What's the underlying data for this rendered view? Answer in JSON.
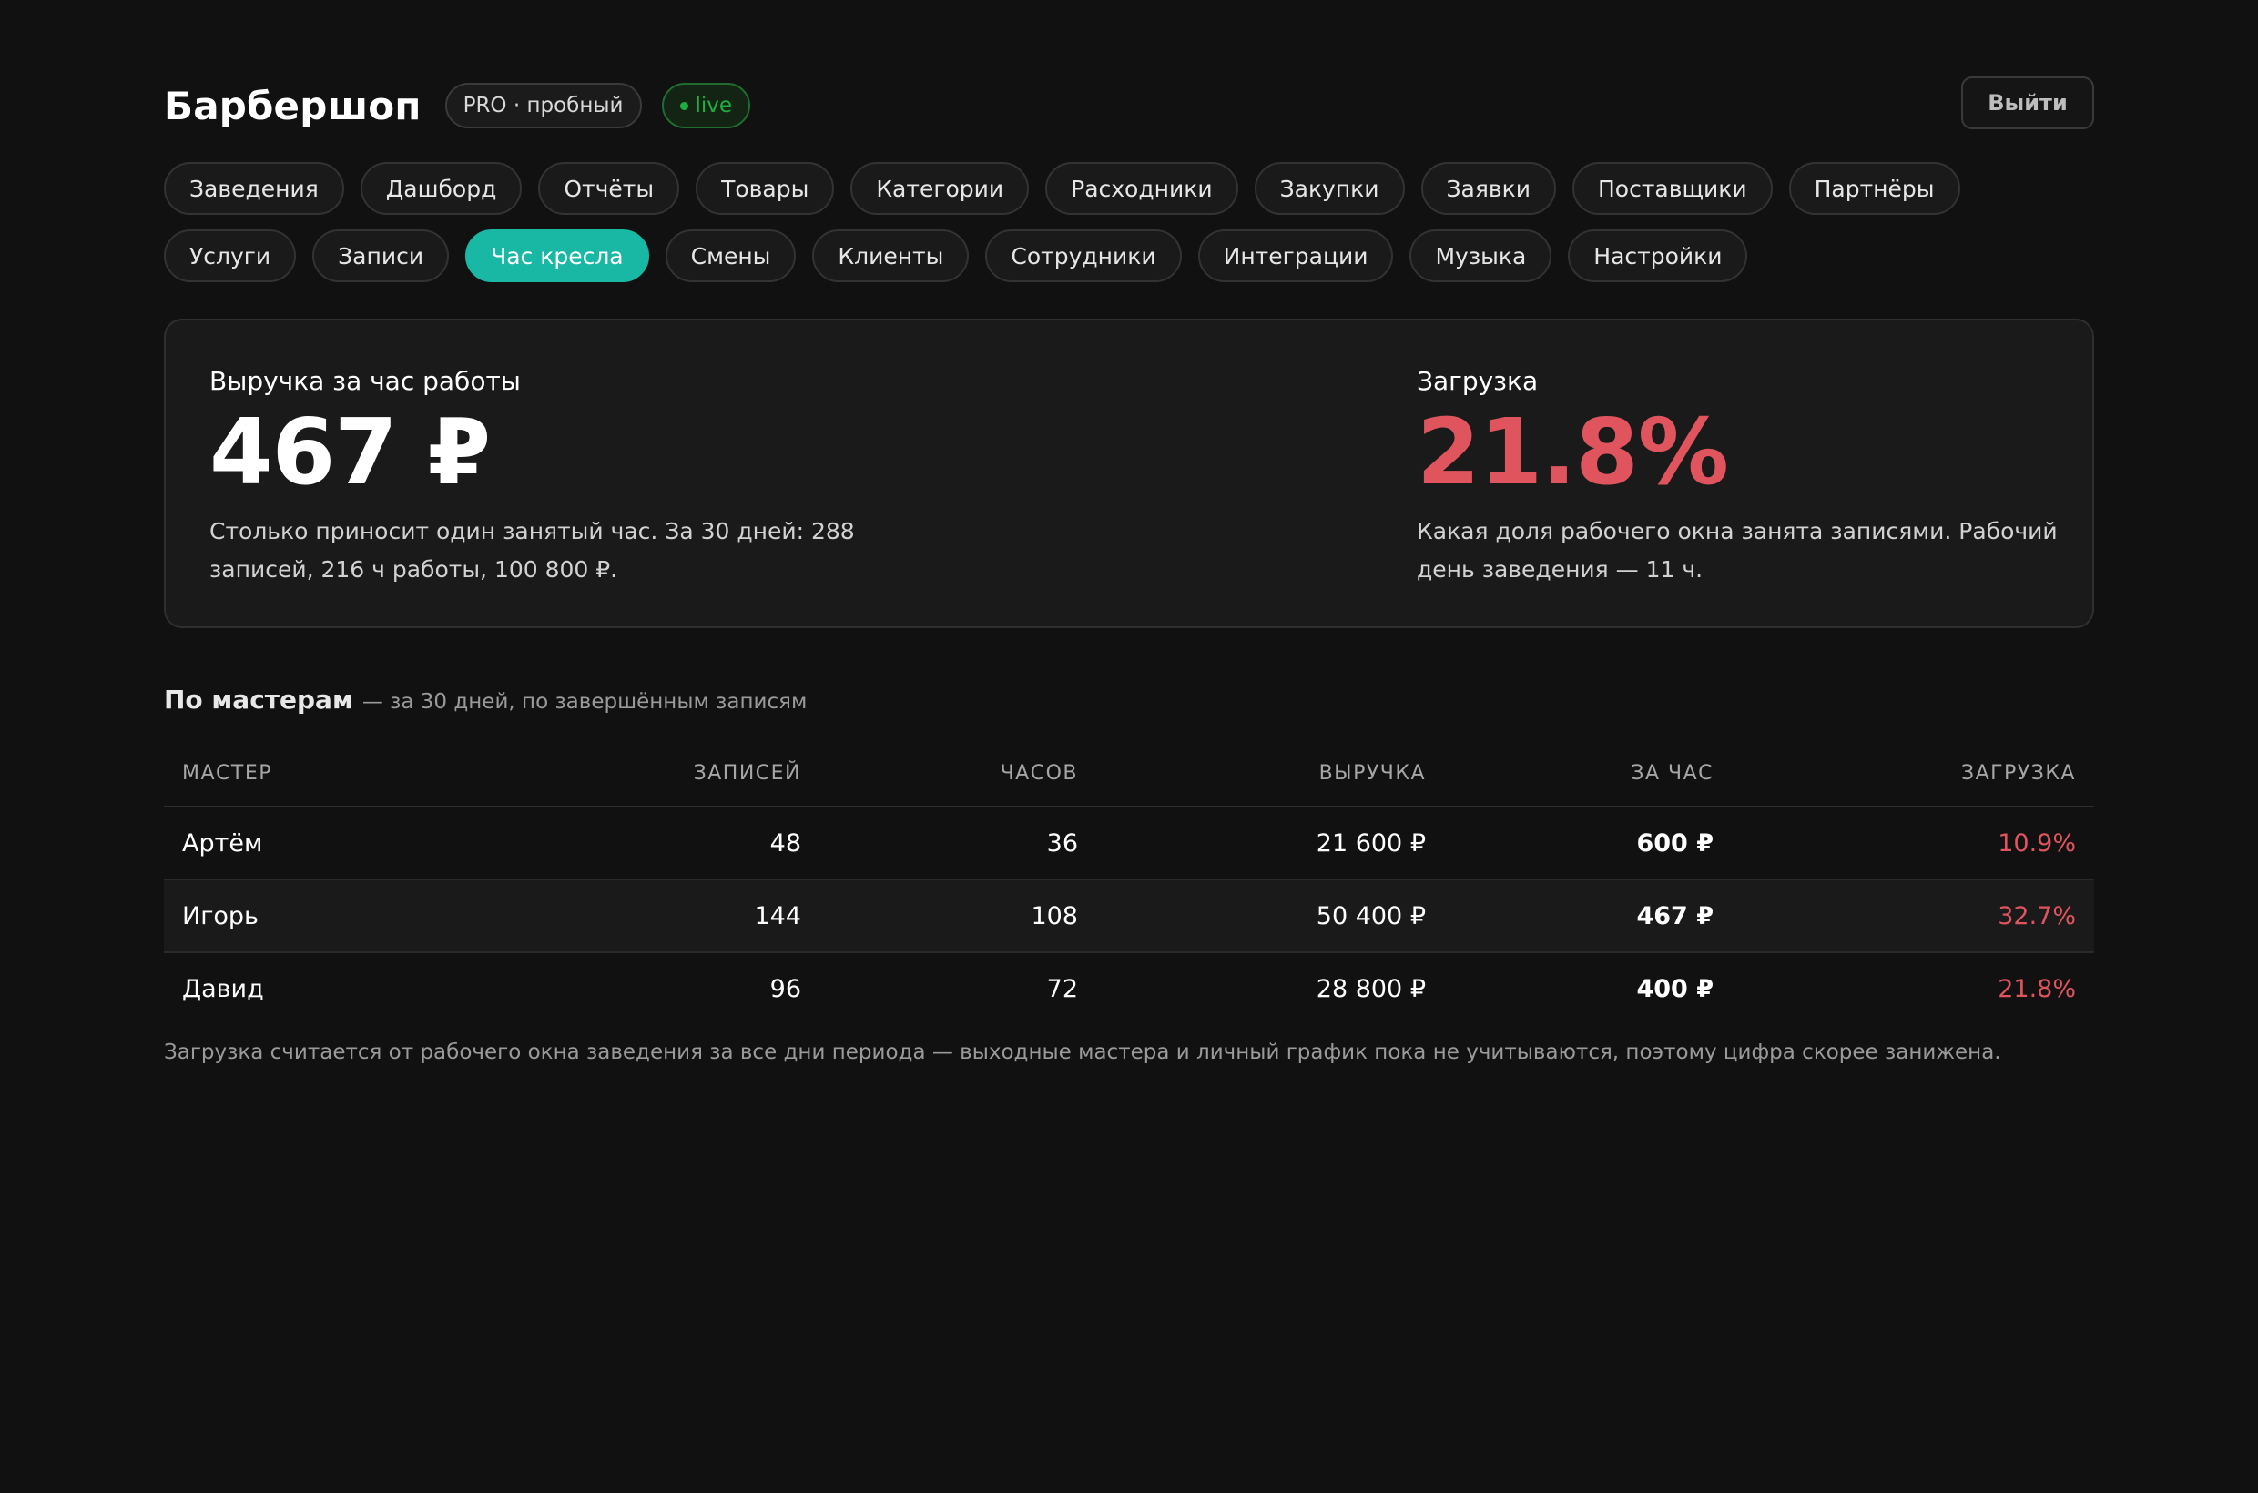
{
  "header": {
    "brand": "Барбершоп",
    "plan_badge": "PRO · пробный",
    "live_badge": "live",
    "logout_label": "Выйти"
  },
  "nav": {
    "items": [
      "Заведения",
      "Дашборд",
      "Отчёты",
      "Товары",
      "Категории",
      "Расходники",
      "Закупки",
      "Заявки",
      "Поставщики",
      "Партнёры",
      "Услуги",
      "Записи",
      "Час кресла",
      "Смены",
      "Клиенты",
      "Сотрудники",
      "Интеграции",
      "Музыка",
      "Настройки"
    ],
    "active": "Час кресла"
  },
  "kpis": {
    "revenue": {
      "title": "Выручка за час работы",
      "value": "467 ₽",
      "desc_line1": "Столько приносит один занятый час. За 30 дней: 288",
      "desc_line2": "записей, 216 ч работы, 100 800 ₽."
    },
    "load": {
      "title": "Загрузка",
      "value": "21.8%",
      "desc_line1": "Какая доля рабочего окна занята записями. Рабочий",
      "desc_line2": "день заведения — 11 ч."
    }
  },
  "section": {
    "title": "По мастерам",
    "subtitle": "— за 30 дней, по завершённым записям"
  },
  "table": {
    "columns": [
      "МАСТЕР",
      "ЗАПИСЕЙ",
      "ЧАСОВ",
      "ВЫРУЧКА",
      "ЗА ЧАС",
      "ЗАГРУЗКА"
    ],
    "rows": [
      {
        "master": "Артём",
        "records": "48",
        "hours": "36",
        "revenue": "21 600 ₽",
        "per_hour": "600 ₽",
        "load": "10.9%"
      },
      {
        "master": "Игорь",
        "records": "144",
        "hours": "108",
        "revenue": "50 400 ₽",
        "per_hour": "467 ₽",
        "load": "32.7%"
      },
      {
        "master": "Давид",
        "records": "96",
        "hours": "72",
        "revenue": "28 800 ₽",
        "per_hour": "400 ₽",
        "load": "21.8%"
      }
    ]
  },
  "footnote": "Загрузка считается от рабочего окна заведения за все дни периода — выходные мастера и личный график пока не учитываются, поэтому цифра скорее занижена.",
  "colors": {
    "accent": "#19b8a4",
    "live": "#1fae3f",
    "bad": "#e0545d",
    "background": "#111111"
  }
}
